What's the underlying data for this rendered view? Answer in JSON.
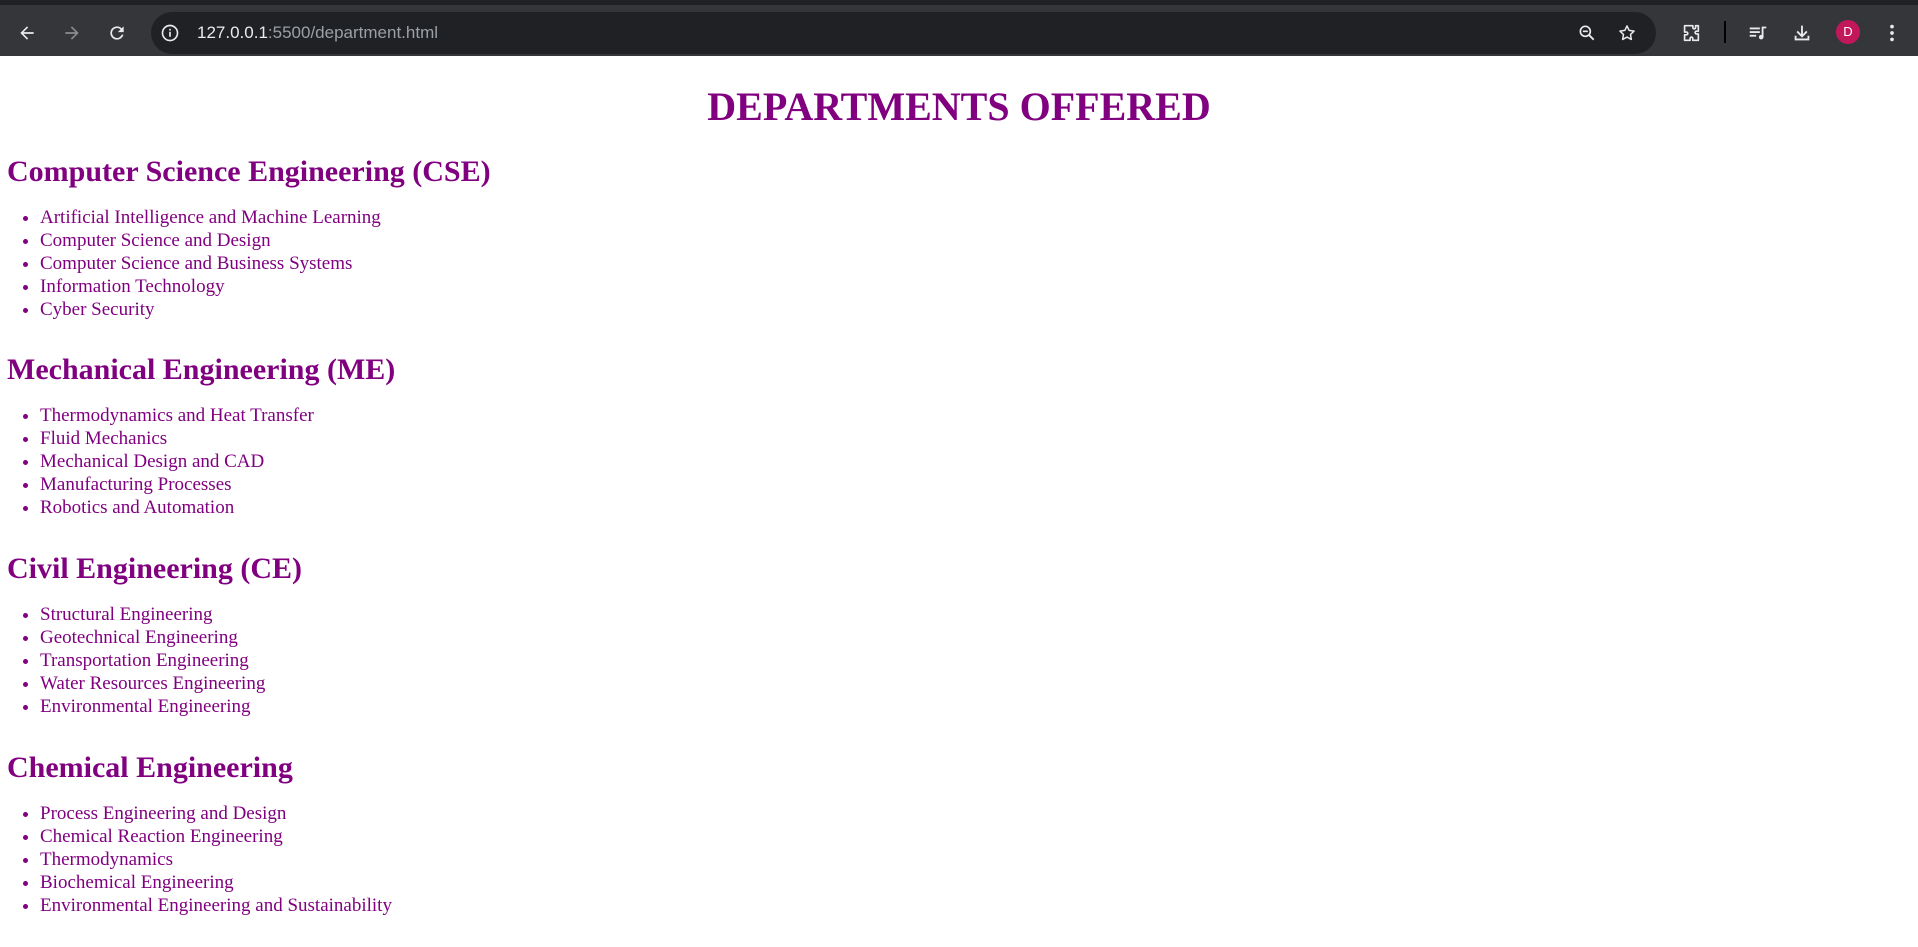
{
  "browser": {
    "host": "127.0.0.1",
    "path": ":5500/department.html",
    "profile_initial": "D",
    "icons": {
      "back": "arrow-left-icon",
      "forward": "arrow-right-icon",
      "reload": "reload-icon",
      "site_info": "info-icon",
      "zoom": "zoom-out-icon",
      "bookmark": "star-icon",
      "extensions": "puzzle-icon",
      "media": "media-queue-icon",
      "downloads": "download-icon",
      "menu": "kebab-menu-icon"
    }
  },
  "page": {
    "title": "DEPARTMENTS OFFERED",
    "text_color": "#800080",
    "departments": [
      {
        "name": "Computer Science Engineering (CSE)",
        "items": [
          "Artificial Intelligence and Machine Learning",
          "Computer Science and Design",
          "Computer Science and Business Systems",
          "Information Technology",
          "Cyber Security"
        ]
      },
      {
        "name": "Mechanical Engineering (ME)",
        "items": [
          "Thermodynamics and Heat Transfer",
          "Fluid Mechanics",
          "Mechanical Design and CAD",
          "Manufacturing Processes",
          "Robotics and Automation"
        ]
      },
      {
        "name": "Civil Engineering (CE)",
        "items": [
          "Structural Engineering",
          "Geotechnical Engineering",
          "Transportation Engineering",
          "Water Resources Engineering",
          "Environmental Engineering"
        ]
      },
      {
        "name": "Chemical Engineering",
        "items": [
          "Process Engineering and Design",
          "Chemical Reaction Engineering",
          "Thermodynamics",
          "Biochemical Engineering",
          "Environmental Engineering and Sustainability"
        ]
      }
    ]
  }
}
